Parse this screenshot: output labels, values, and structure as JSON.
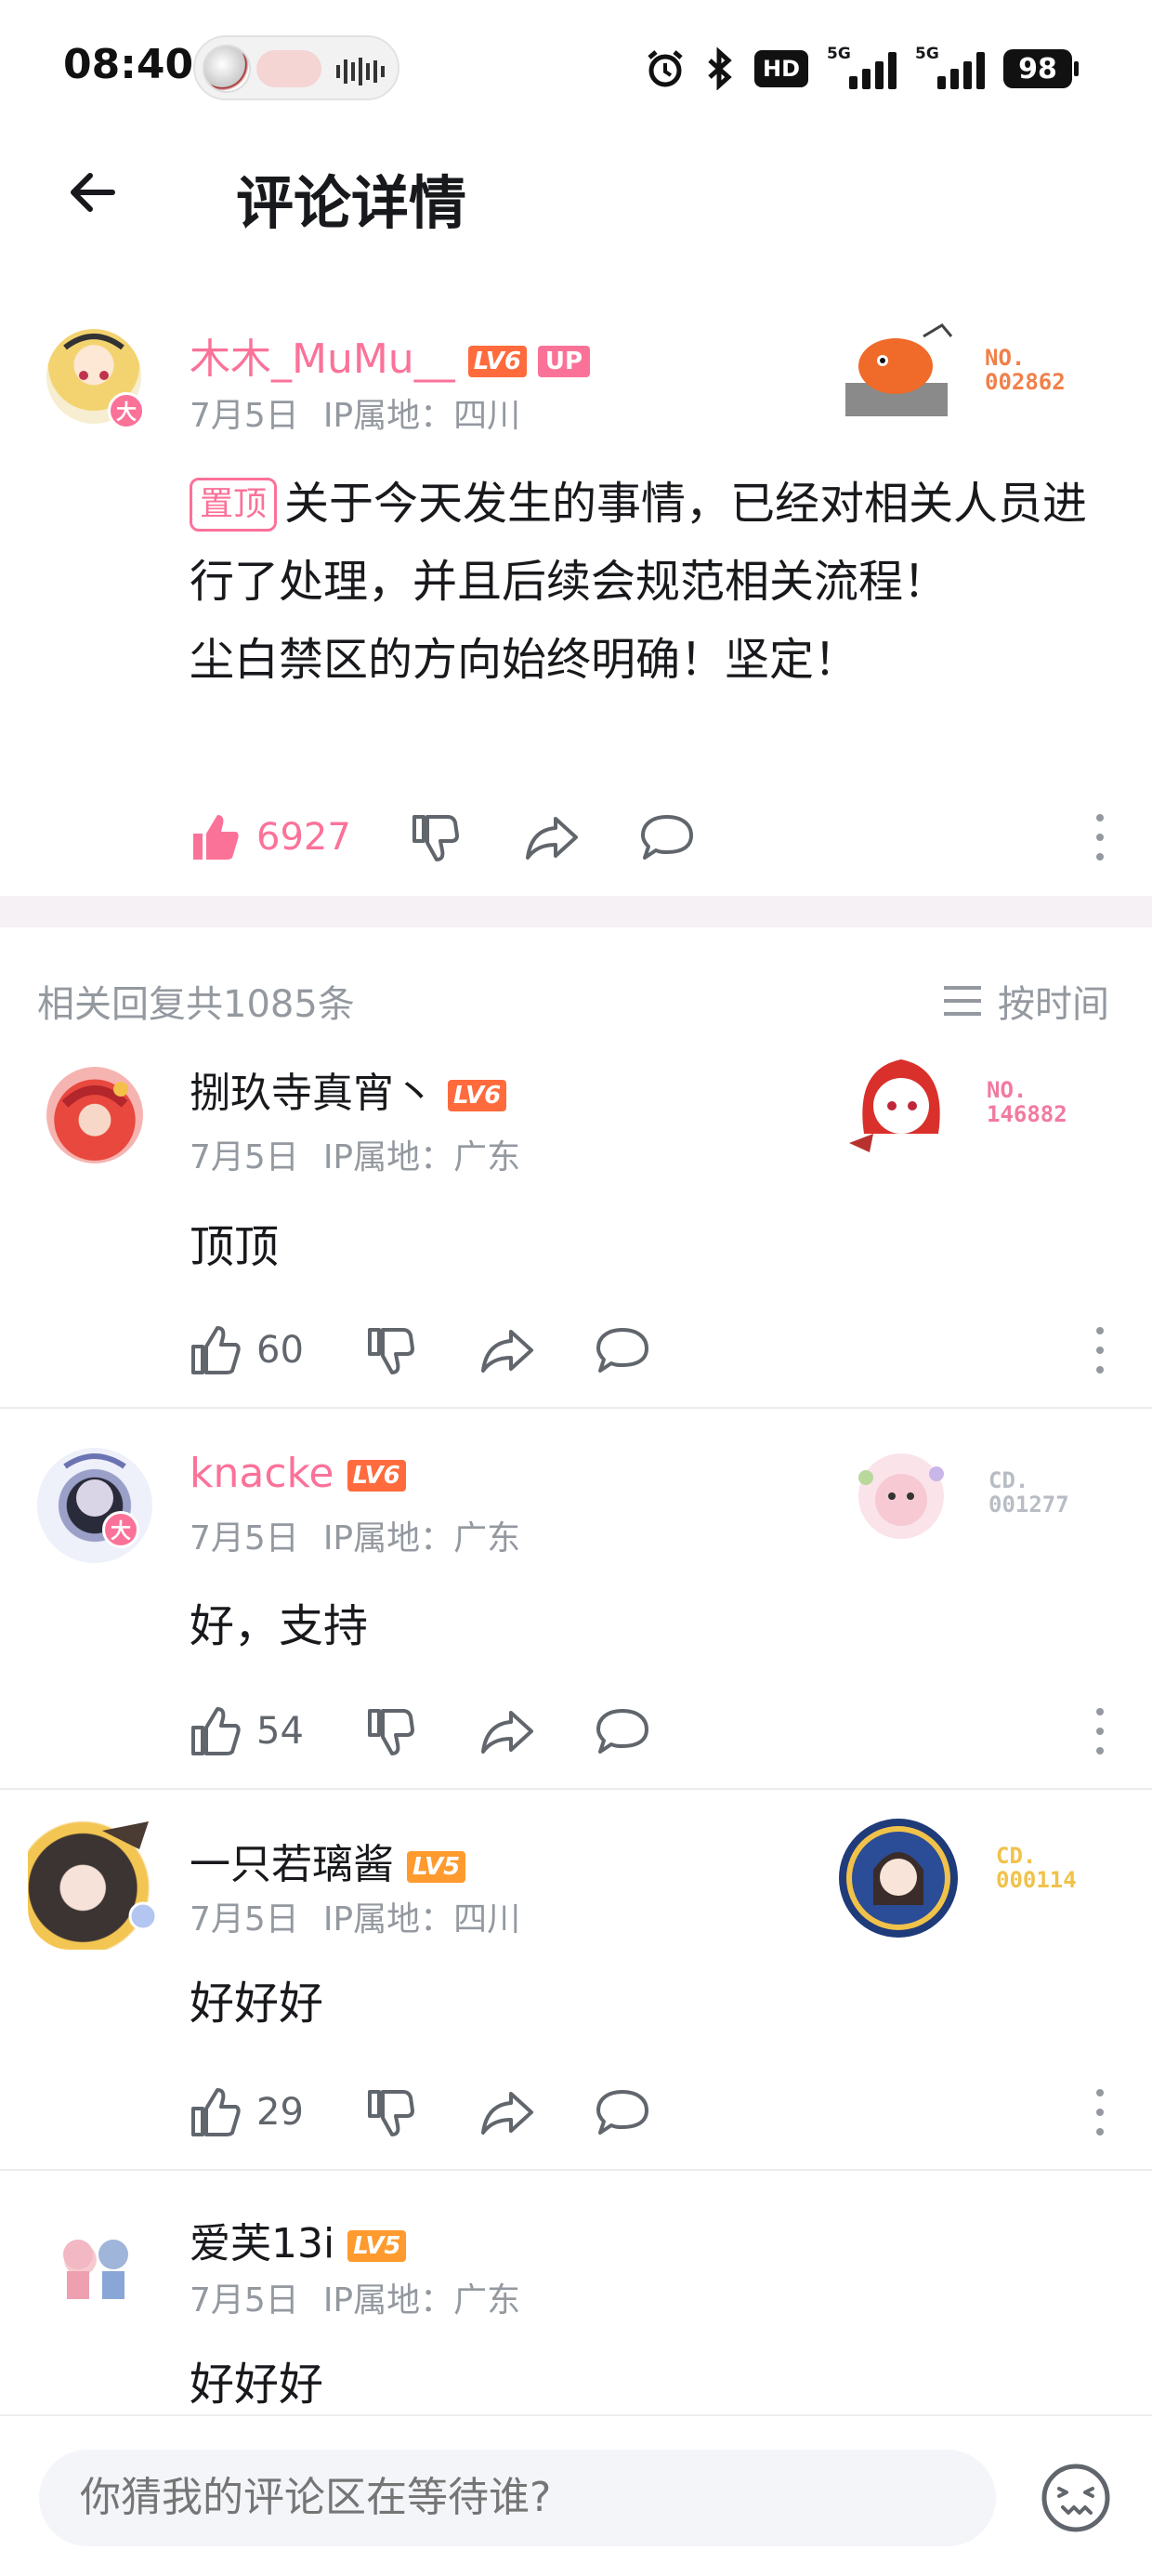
{
  "status_bar": {
    "time": "08:40",
    "hd_label": "HD",
    "net_label": "5G",
    "battery": "98"
  },
  "header": {
    "title": "评论详情"
  },
  "main_comment": {
    "username": "木木_MuMu__",
    "level": "LV6",
    "up_badge": "UP",
    "avatar_badge": "大",
    "date": "7月5日",
    "ip": "IP属地：四川",
    "pin_label": "置顶",
    "content_line1": "关于今天发生的事情，已经对相关人员进行了处理，并且后续会规范相关流程！",
    "content_line2": "尘白禁区的方向始终明确！坚定！",
    "likes": "6927",
    "decor_no_label": "NO.",
    "decor_no_value": "002862"
  },
  "replies_header": {
    "count_label": "相关回复共1085条",
    "sort_label": "按时间"
  },
  "replies": [
    {
      "username": "捌玖寺真宵丶",
      "level": "LV6",
      "date": "7月5日",
      "ip": "IP属地：广东",
      "content": "顶顶",
      "likes": "60",
      "decor_label": "NO.",
      "decor_value": "146882"
    },
    {
      "username": "knacke",
      "level": "LV6",
      "avatar_badge": "大",
      "date": "7月5日",
      "ip": "IP属地：广东",
      "content": "好，支持",
      "likes": "54",
      "decor_label": "CD.",
      "decor_value": "001277"
    },
    {
      "username": "一只若璃酱",
      "level": "LV5",
      "date": "7月5日",
      "ip": "IP属地：四川",
      "content": "好好好",
      "likes": "29",
      "decor_label": "CD.",
      "decor_value": "000114"
    },
    {
      "username": "爱芙13i",
      "level": "LV5",
      "date": "7月5日",
      "ip": "IP属地：广东",
      "content": "好好好"
    }
  ],
  "bottom_bar": {
    "input_placeholder": "你猜我的评论区在等待谁?"
  },
  "colors": {
    "accent": "#fb7299",
    "level6": "#ff6b3d",
    "level5": "#ff9a2e",
    "meta_gray": "#9499a0"
  }
}
